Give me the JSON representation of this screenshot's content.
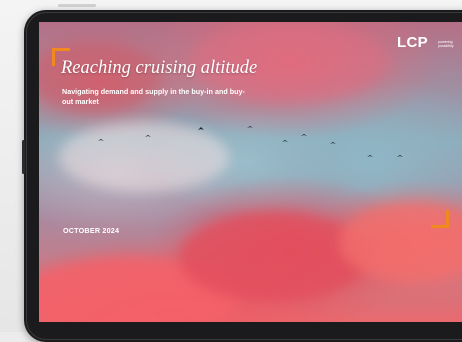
{
  "report": {
    "title": "Reaching cruising altitude",
    "subtitle": "Navigating demand and supply in the buy-in and buy-out market",
    "date": "OCTOBER 2024"
  },
  "brand": {
    "logo_text": "LCP",
    "logo_tagline": "powering possibility",
    "accent_color": "#f08a1e"
  },
  "device": {
    "frame_color": "#1b1b1d",
    "bird_icon_count": 9
  }
}
